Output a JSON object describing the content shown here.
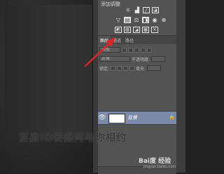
{
  "adjustments": {
    "title": "添加调整",
    "row1_icons": [
      "brightness-icon",
      "levels-icon",
      "curves-icon",
      "exposure-icon"
    ],
    "row2_icons": [
      "vibrance-icon",
      "hue-saturation-icon",
      "color-balance-icon",
      "black-white-icon",
      "photo-filter-icon",
      "channel-mixer-icon"
    ],
    "row3_icons": [
      "invert-icon",
      "posterize-icon",
      "threshold-icon",
      "gradient-map-icon",
      "selective-color-icon"
    ]
  },
  "layers": {
    "tabs": [
      "图层",
      "通道",
      "路径"
    ],
    "active_tab": 0,
    "filter_label": "类型",
    "blend_mode": "正常",
    "opacity_label": "不透明度:",
    "lock_label": "锁定:",
    "fill_label": "填充:",
    "layer_items": [
      {
        "name": "背景",
        "visible": true,
        "locked": true
      }
    ]
  },
  "watermark": {
    "text": "百度ID云然河与你相约",
    "logo": "Bai度 经验",
    "url": "jingyan.baidu.com"
  },
  "accent_arrow_color": "#d8262a"
}
